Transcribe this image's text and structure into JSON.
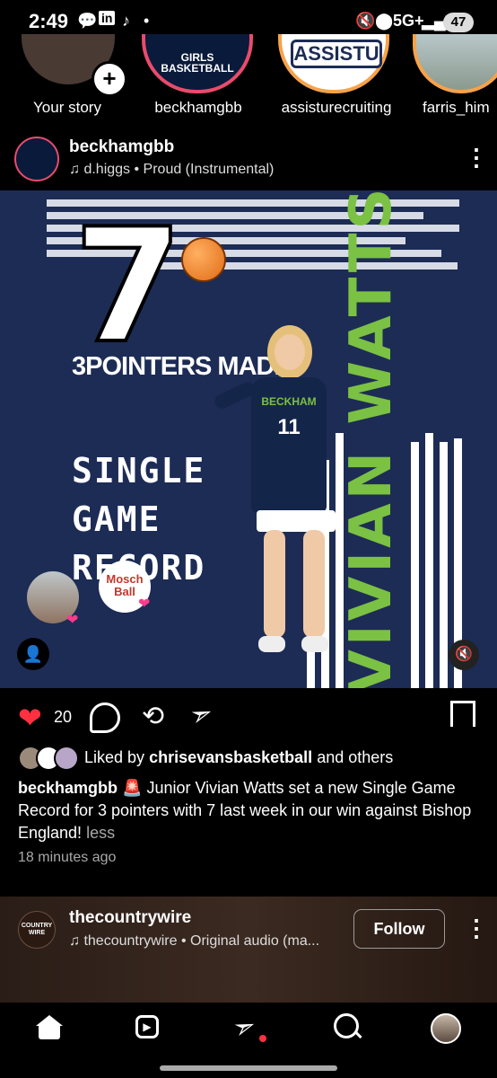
{
  "status": {
    "time": "2:49",
    "network": "5G+",
    "battery": "47"
  },
  "stories": [
    {
      "label": "Your story",
      "ring": "none"
    },
    {
      "label": "beckhamgbb",
      "ring": "gradient",
      "inner_text": "GIRLS BASKETBALL"
    },
    {
      "label": "assisturecruiting",
      "ring": "gradient",
      "inner_text": "ASSISTU"
    },
    {
      "label": "farris_him",
      "ring": "gradient"
    }
  ],
  "post": {
    "username": "beckhamgbb",
    "audio": "d.higgs • Proud (Instrumental)",
    "image": {
      "number": "7",
      "subhead": "3POINTERS MADE",
      "record_lines": [
        "SINGLE",
        "GAME",
        "RECORD"
      ],
      "name": "VIVIAN WATTS",
      "jersey": "11",
      "jersey_text": "BECKHAM",
      "logo_text": "Mosch Ball"
    },
    "like_count": "20",
    "liked_by_prefix": "Liked by",
    "liked_by_user": "chrisevansbasketball",
    "liked_by_suffix": "and others",
    "caption_user": "beckhamgbb",
    "caption_text": "🚨 Junior Vivian Watts set a new Single Game Record for 3 pointers with 7 last week in our win against Bishop England!",
    "caption_more": "less",
    "time_ago": "18 minutes ago"
  },
  "next_post": {
    "username": "thecountrywire",
    "audio": "thecountrywire • Original audio (ma...",
    "follow_label": "Follow",
    "avatar_text": "COUNTRY WIRE"
  },
  "colors": {
    "like": "#ff3040",
    "accent_green": "#7bc143",
    "post_bg": "#1d2c55"
  },
  "nav": [
    "home-icon",
    "reels-icon",
    "direct-icon",
    "search-icon",
    "profile-avatar"
  ]
}
